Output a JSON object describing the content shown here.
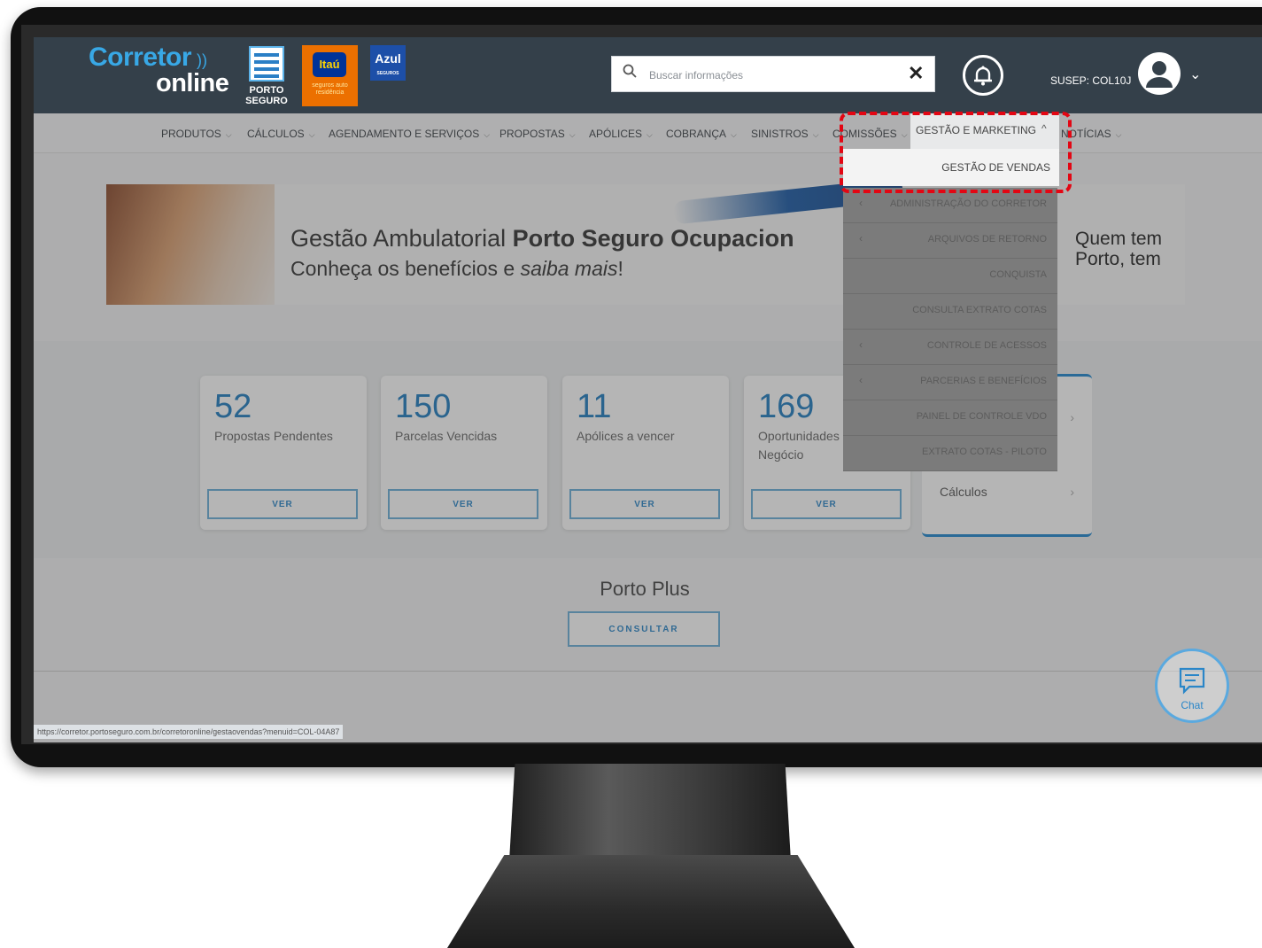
{
  "header": {
    "logo_line1": "Corretor",
    "logo_line2": "online",
    "porto_label": "PORTO SEGURO",
    "itau_label": "Itaú",
    "itau_sub": "seguros auto residência",
    "azul_label": "Azul",
    "azul_sub": "SEGUROS",
    "search_placeholder": "Buscar informações",
    "search_clear": "✕",
    "susep": "SUSEP: COL10J",
    "chevron": "⌄"
  },
  "nav": {
    "items": [
      {
        "label": "PRODUTOS"
      },
      {
        "label": "CÁLCULOS"
      },
      {
        "label": "AGENDAMENTO E SERVIÇOS"
      },
      {
        "label": "PROPOSTAS"
      },
      {
        "label": "APÓLICES"
      },
      {
        "label": "COBRANÇA"
      },
      {
        "label": "SINISTROS"
      },
      {
        "label": "COMISSÕES"
      },
      {
        "label": "GESTÃO E MARKETING"
      },
      {
        "label": "NOTÍCIAS"
      }
    ],
    "tick_chevron": "⌵",
    "up_chevron": "^"
  },
  "dropdown": {
    "first": "GESTÃO DE VENDAS",
    "items": [
      {
        "label": "ADMINISTRAÇÃO DO CORRETOR",
        "has_arrow": true
      },
      {
        "label": "ARQUIVOS DE RETORNO",
        "has_arrow": true
      },
      {
        "label": "CONQUISTA",
        "has_arrow": false
      },
      {
        "label": "CONSULTA EXTRATO COTAS",
        "has_arrow": false
      },
      {
        "label": "CONTROLE DE ACESSOS",
        "has_arrow": true
      },
      {
        "label": "PARCERIAS E BENEFÍCIOS",
        "has_arrow": true
      },
      {
        "label": "PAINEL DE CONTROLE VDO",
        "has_arrow": false
      },
      {
        "label": "EXTRATO COTAS - PILOTO",
        "has_arrow": false
      }
    ],
    "arrow": "‹"
  },
  "banner": {
    "title_regular": "Gestão Ambulatorial ",
    "title_bold": "Porto Seguro Ocupacion",
    "subtitle_regular": "Conheça os benefícios e ",
    "subtitle_italic": "saiba mais",
    "subtitle_end": "!",
    "right_line1": "Quem tem",
    "right_line2": "Porto, tem"
  },
  "cards": [
    {
      "number": "52",
      "label": "Propostas Pendentes",
      "button": "VER"
    },
    {
      "number": "150",
      "label": "Parcelas Vencidas",
      "button": "VER"
    },
    {
      "number": "11",
      "label": "Apólices a vencer",
      "button": "VER"
    },
    {
      "number": "169",
      "label": "Oportunidades de Negócio",
      "button": "VER"
    }
  ],
  "quick": {
    "rows": [
      {
        "label": ""
      },
      {
        "label": "Cálculos"
      }
    ],
    "chev": "›"
  },
  "porto_plus": {
    "title": "Porto Plus",
    "button": "CONSULTAR"
  },
  "chat": {
    "label": "Chat"
  },
  "status_url": "https://corretor.portoseguro.com.br/corretoronline/gestaovendas?menuid=COL-04A87",
  "colors": {
    "header_bg": "#34404a",
    "accent_blue": "#1f7cc0",
    "highlight_red": "#e30613",
    "itau_orange": "#ec7000"
  }
}
